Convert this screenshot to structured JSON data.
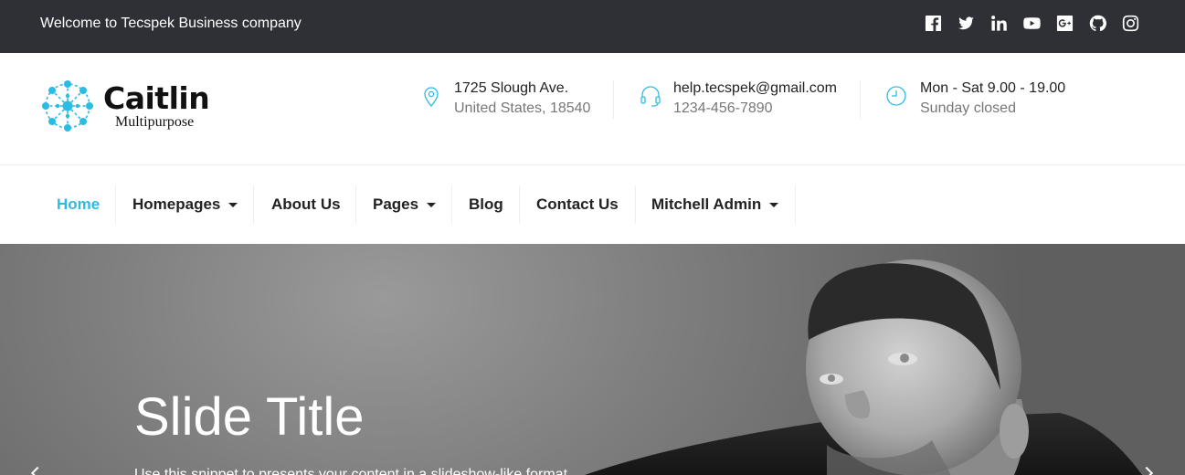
{
  "topbar": {
    "welcome": "Welcome to Tecspek Business company",
    "socials": [
      "facebook-icon",
      "twitter-icon",
      "linkedin-icon",
      "youtube-icon",
      "google-plus-icon",
      "github-icon",
      "instagram-icon"
    ]
  },
  "logo": {
    "name": "Caitlin",
    "tagline": "Multipurpose"
  },
  "contact": {
    "address_line1": "1725 Slough Ave.",
    "address_line2": "United States, 18540",
    "email": "help.tecspek@gmail.com",
    "phone": "1234-456-7890",
    "hours": "Mon - Sat 9.00 - 19.00",
    "closed": "Sunday closed"
  },
  "nav": {
    "items": [
      {
        "label": "Home",
        "active": true
      },
      {
        "label": "Homepages",
        "dropdown": true
      },
      {
        "label": "About Us"
      },
      {
        "label": "Pages",
        "dropdown": true
      },
      {
        "label": "Blog"
      },
      {
        "label": "Contact Us"
      },
      {
        "label": "Mitchell Admin",
        "dropdown": true
      }
    ]
  },
  "hero": {
    "title": "Slide Title",
    "subtitle": "Use this snippet to presents your content in a slideshow-like format."
  },
  "colors": {
    "accent": "#2bbce4",
    "topbar_bg": "#2f3035",
    "text_dark": "#222222",
    "text_muted": "#777777"
  }
}
